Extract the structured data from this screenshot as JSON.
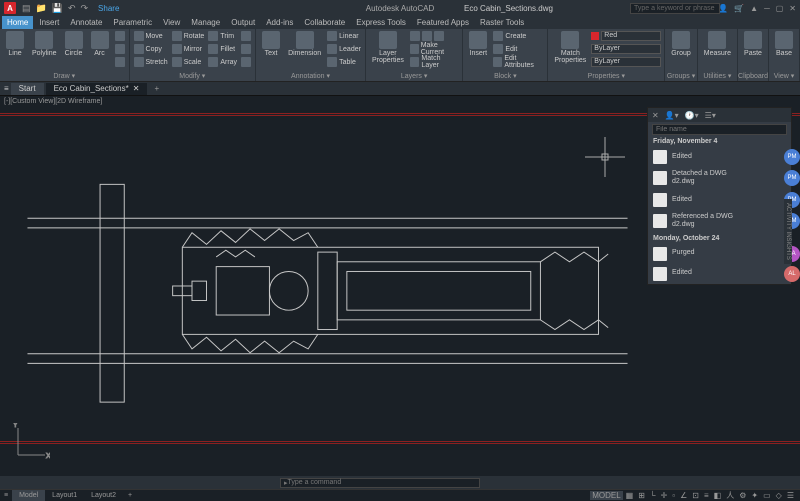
{
  "title": {
    "app": "Autodesk AutoCAD",
    "file": "Eco Cabin_Sections.dwg",
    "search_ph": "Type a keyword or phrase",
    "share": "Share"
  },
  "menus": [
    "Home",
    "Insert",
    "Annotate",
    "Parametric",
    "View",
    "Manage",
    "Output",
    "Add-ins",
    "Collaborate",
    "Express Tools",
    "Featured Apps",
    "Raster Tools"
  ],
  "ribbon": {
    "draw": {
      "label": "Draw ▾",
      "line": "Line",
      "polyline": "Polyline",
      "circle": "Circle",
      "arc": "Arc"
    },
    "modify": {
      "label": "Modify ▾",
      "move": "Move",
      "rotate": "Rotate",
      "trim": "Trim",
      "copy": "Copy",
      "mirror": "Mirror",
      "fillet": "Fillet",
      "stretch": "Stretch",
      "scale": "Scale",
      "array": "Array"
    },
    "annotation": {
      "label": "Annotation ▾",
      "text": "Text",
      "dim": "Dimension",
      "linear": "Linear",
      "leader": "Leader",
      "table": "Table"
    },
    "layers": {
      "label": "Layers ▾",
      "layer_props": "Layer\nProperties",
      "make_current": "Make Current",
      "match_layer": "Match Layer"
    },
    "block": {
      "label": "Block ▾",
      "insert": "Insert",
      "create": "Create",
      "edit": "Edit",
      "edit_attr": "Edit Attributes"
    },
    "properties": {
      "label": "Properties ▾",
      "match": "Match\nProperties",
      "color": "Red",
      "bylayer1": "ByLayer",
      "bylayer2": "ByLayer"
    },
    "groups": {
      "label": "Groups ▾",
      "group": "Group"
    },
    "utilities": {
      "label": "Utilities ▾",
      "measure": "Measure"
    },
    "clipboard": {
      "label": "Clipboard",
      "paste": "Paste"
    },
    "view": {
      "label": "View ▾",
      "base": "Base"
    }
  },
  "filetabs": {
    "start": "Start",
    "file": "Eco Cabin_Sections*"
  },
  "viewlabel": "[-][Custom View][2D Wireframe]",
  "panel": {
    "search_ph": "File name",
    "date1": "Friday, November 4",
    "date2": "Monday, October 24",
    "items": [
      {
        "t": "Edited",
        "b": "PM"
      },
      {
        "t": "Detached a DWG\nd2.dwg",
        "b": "PM"
      },
      {
        "t": "Edited",
        "b": "PM"
      },
      {
        "t": "Referenced a DWG\nd2.dwg",
        "b": "PM"
      },
      {
        "t": "Purged",
        "b": "LA"
      },
      {
        "t": "Edited",
        "b": "AL"
      }
    ],
    "insights": "ACTIVITY INSIGHTS"
  },
  "cmd": "Type a command",
  "layouts": {
    "model": "Model",
    "l1": "Layout1",
    "l2": "Layout2"
  },
  "status": {
    "model": "MODEL"
  }
}
